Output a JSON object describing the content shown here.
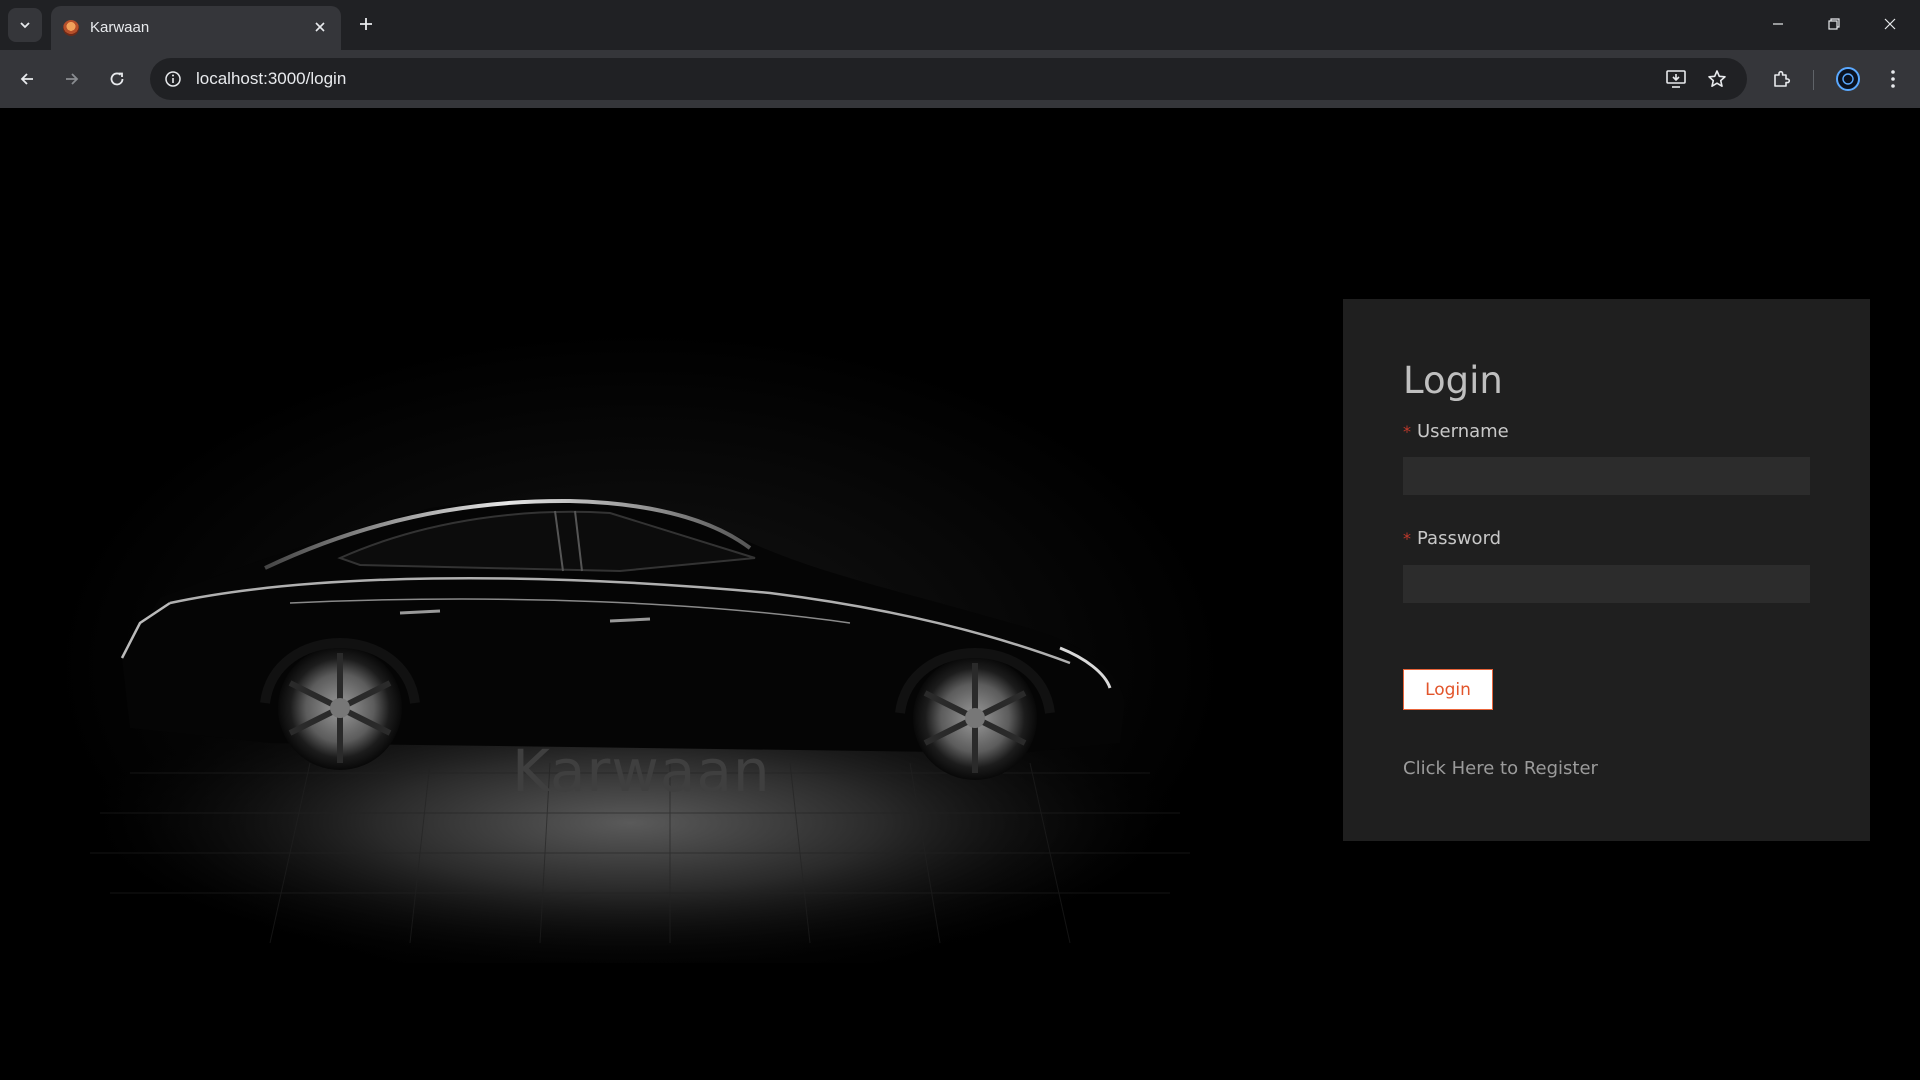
{
  "browser": {
    "tab_title": "Karwaan",
    "url": "localhost:3000/login"
  },
  "hero": {
    "brand_text": "Karwaan"
  },
  "login": {
    "heading": "Login",
    "required_marker": "*",
    "username_label": "Username",
    "username_value": "",
    "password_label": "Password",
    "password_value": "",
    "submit_label": "Login",
    "register_link": "Click Here to Register"
  },
  "colors": {
    "accent": "#e2552b",
    "card_background": "#1f1f1f",
    "input_background": "#2c2c2c",
    "required": "#c0392b"
  }
}
